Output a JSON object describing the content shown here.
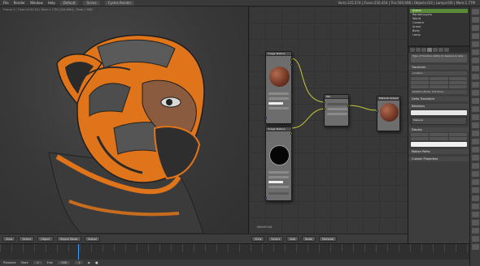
{
  "top_menu": {
    "items": [
      "File",
      "Render",
      "Window",
      "Help"
    ],
    "layout_field": "Default",
    "scene_field": "Scene",
    "render_engine": "Cycles Render",
    "stats": "Verts:125,574 | Faces:250,454 | Tris:500,908 | Objects:0/3 | Lamps:0/0 | Mem:1.77M"
  },
  "viewport": {
    "info_text": "Frame:1 | Time:00:00.04 | Mem:1.77M (444.68M) | Peak:7.96M",
    "toolbar_buttons": [
      "View",
      "Select",
      "Object",
      "Object Mode",
      "Global"
    ]
  },
  "node_editor": {
    "footer_label": "MetalOrbit",
    "toolbar_buttons": [
      "View",
      "Select",
      "Add",
      "Node",
      "Material"
    ],
    "nodes": {
      "top_title": "Image Texture",
      "bottom_title": "Image Texture",
      "mix_title": "Mix",
      "output_title": "Material Output"
    }
  },
  "properties": {
    "outliner_items": [
      "Scene",
      "RenderLayers",
      "World",
      "Camera",
      "Armor",
      "Body",
      "Lamp"
    ],
    "selected_index": 0,
    "headers": [
      "Transform",
      "Delta Transform",
      "Relations",
      "Display",
      "Motion Paths",
      "Custom Properties"
    ],
    "rows": [
      "Type of function ability to displace & hide",
      "Location",
      "Rotation",
      "Scale",
      "Rotation Mode:  XYZ Euler"
    ],
    "material_label": "Material"
  },
  "timeline": {
    "start_label": "Start:",
    "start_value": "1",
    "end_label": "End:",
    "end_value": "250",
    "current_frame": "1",
    "play_label": "Playback"
  },
  "colors": {
    "accent_orange": "#e0741a",
    "selection_green": "#5a8a3a",
    "socket_yellow": "#c8c83a",
    "frame_cursor": "#3ea0ff"
  }
}
